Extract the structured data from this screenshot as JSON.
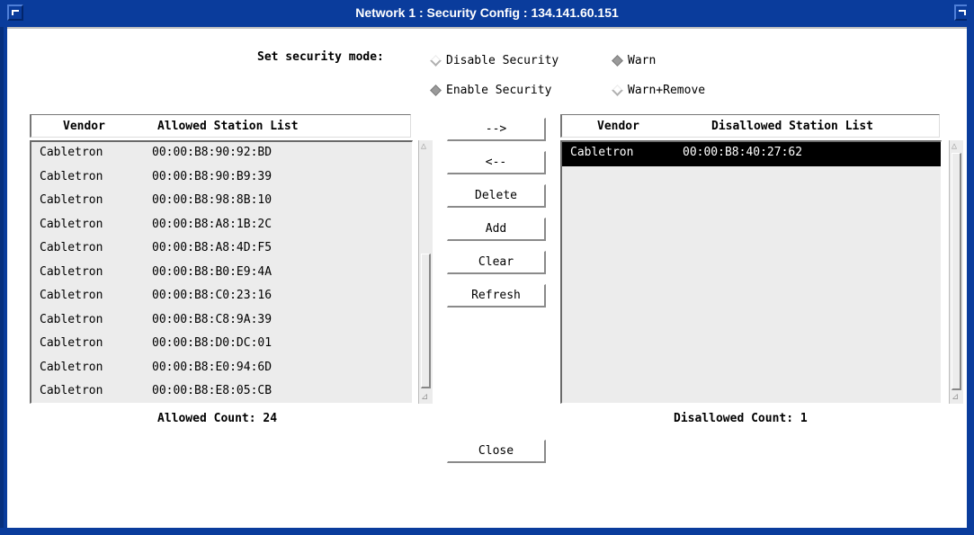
{
  "window": {
    "title": "Network 1 : Security Config : 134.141.60.151"
  },
  "security_mode": {
    "label": "Set security mode:",
    "options": [
      {
        "label": "Disable Security",
        "selected": false
      },
      {
        "label": "Warn",
        "selected": true
      },
      {
        "label": "Enable Security",
        "selected": true
      },
      {
        "label": "Warn+Remove",
        "selected": false
      }
    ]
  },
  "allowed": {
    "vendor_header": "Vendor",
    "list_header": "Allowed Station List",
    "rows": [
      {
        "vendor": "Cabletron",
        "mac": "00:00:B8:90:92:BD"
      },
      {
        "vendor": "Cabletron",
        "mac": "00:00:B8:90:B9:39"
      },
      {
        "vendor": "Cabletron",
        "mac": "00:00:B8:98:8B:10"
      },
      {
        "vendor": "Cabletron",
        "mac": "00:00:B8:A8:1B:2C"
      },
      {
        "vendor": "Cabletron",
        "mac": "00:00:B8:A8:4D:F5"
      },
      {
        "vendor": "Cabletron",
        "mac": "00:00:B8:B0:E9:4A"
      },
      {
        "vendor": "Cabletron",
        "mac": "00:00:B8:C0:23:16"
      },
      {
        "vendor": "Cabletron",
        "mac": "00:00:B8:C8:9A:39"
      },
      {
        "vendor": "Cabletron",
        "mac": "00:00:B8:D0:DC:01"
      },
      {
        "vendor": "Cabletron",
        "mac": "00:00:B8:E0:94:6D"
      },
      {
        "vendor": "Cabletron",
        "mac": "00:00:B8:E8:05:CB"
      }
    ],
    "count_label": "Allowed Count: 24"
  },
  "disallowed": {
    "vendor_header": "Vendor",
    "list_header": "Disallowed Station List",
    "rows": [
      {
        "vendor": "Cabletron",
        "mac": "00:00:B8:40:27:62",
        "selected": true
      }
    ],
    "count_label": "Disallowed Count: 1"
  },
  "buttons": {
    "move_right": "-->",
    "move_left": "<--",
    "delete": "Delete",
    "add": "Add",
    "clear": "Clear",
    "refresh": "Refresh",
    "close": "Close"
  },
  "colors": {
    "titlebar": "#0a3c9c",
    "selection": "#000000"
  }
}
